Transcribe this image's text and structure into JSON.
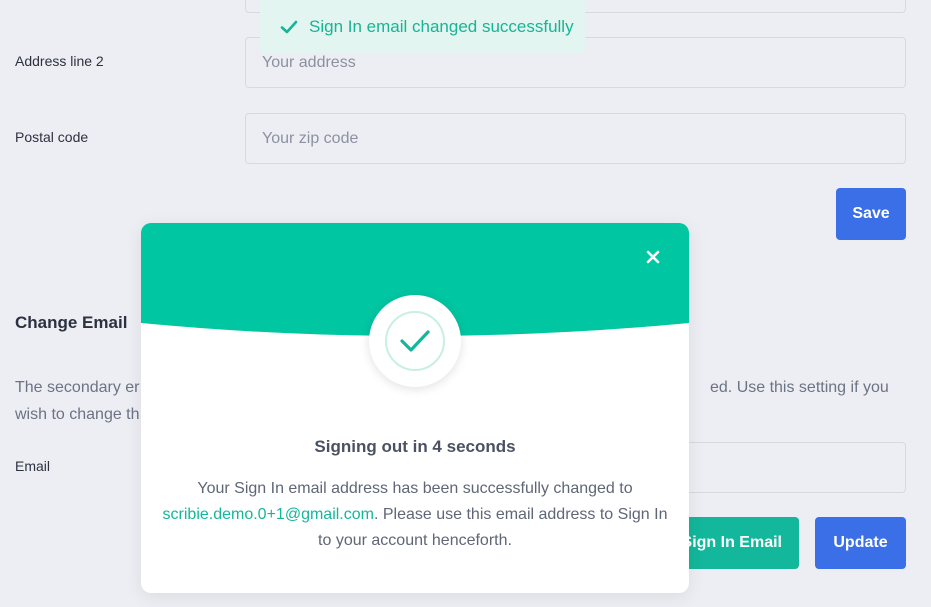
{
  "toast": {
    "message": "Sign In email changed successfully",
    "icon": "check-icon"
  },
  "form": {
    "address_line2": {
      "label": "Address line 2",
      "placeholder": "Your address"
    },
    "postal_code": {
      "label": "Postal code",
      "placeholder": "Your zip code"
    },
    "save_label": "Save"
  },
  "change_email": {
    "title": "Change Email",
    "description_left_line1": "The secondary er",
    "description_left_line2": "wish to change th",
    "description_right_line1": "ed. Use this setting if you",
    "email_label": "Email",
    "sign_in_email_label": "Sign In Email",
    "update_label": "Update"
  },
  "modal": {
    "close_icon": "close-icon",
    "success_icon": "check-circle-icon",
    "title": "Signing out in 4 seconds",
    "body_before": "Your Sign In email address has been successfully changed to",
    "email": "scribie.demo.0+1@gmail.com",
    "body_after": ". Please use this email address to Sign In to your account henceforth."
  },
  "colors": {
    "accent_teal": "#13b79b",
    "header_teal": "#00c6a2",
    "button_blue": "#3a6fe8",
    "background": "#edeef3"
  }
}
